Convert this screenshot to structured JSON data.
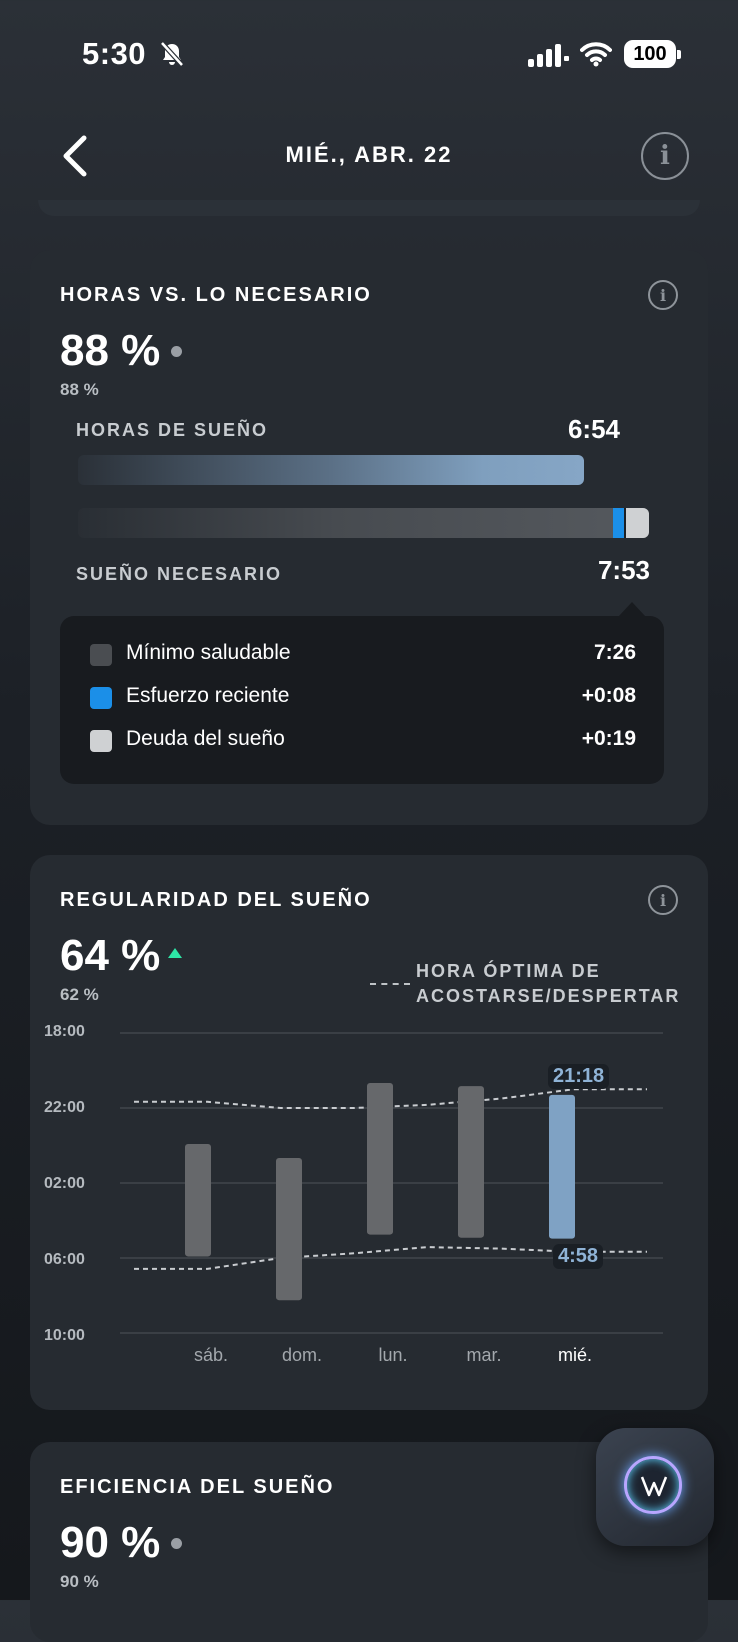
{
  "status_bar": {
    "time": "5:30",
    "battery": "100"
  },
  "header": {
    "title": "MIÉ., ABR. 22"
  },
  "hours_card": {
    "title": "HORAS VS. LO NECESARIO",
    "percent": "88 %",
    "previous_percent": "88 %",
    "sleep_hours_label": "HORAS DE SUEÑO",
    "sleep_hours_value": "6:54",
    "sleep_needed_label": "SUEÑO NECESARIO",
    "sleep_needed_value": "7:53",
    "legend": [
      {
        "label": "Mínimo saludable",
        "value": "7:26",
        "color": "#4a4d51"
      },
      {
        "label": "Esfuerzo reciente",
        "value": "+0:08",
        "color": "#1b8fe8"
      },
      {
        "label": "Deuda del sueño",
        "value": "+0:19",
        "color": "#cfd1d3"
      }
    ]
  },
  "regularity_card": {
    "title": "REGULARIDAD DEL SUEÑO",
    "percent": "64 %",
    "previous_percent": "62 %",
    "trend": "up",
    "legend_line1": "HORA ÓPTIMA DE",
    "legend_line2": "ACOSTARSE/DESPERTAR",
    "bedtime_callout": "21:18",
    "wake_callout": "4:58"
  },
  "efficiency_card": {
    "title": "EFICIENCIA DEL SUEÑO",
    "percent": "90 %",
    "previous_percent": "90 %"
  },
  "chart_data": {
    "type": "bar",
    "title": "",
    "y_axis_ticks": [
      "18:00",
      "22:00",
      "02:00",
      "06:00",
      "10:00"
    ],
    "y_range_hours_since_18": [
      0,
      16
    ],
    "categories": [
      "sáb.",
      "dom.",
      "lun.",
      "mar.",
      "mié."
    ],
    "active_category": "mié.",
    "sleep_ranges": [
      {
        "day": "sáb.",
        "start": "23:55",
        "end": "05:55"
      },
      {
        "day": "dom.",
        "start": "00:40",
        "end": "08:15"
      },
      {
        "day": "lun.",
        "start": "20:40",
        "end": "04:45"
      },
      {
        "day": "mar.",
        "start": "20:50",
        "end": "04:55"
      },
      {
        "day": "mié.",
        "start": "21:18",
        "end": "4:58"
      }
    ],
    "optimal_bedtime": [
      "21:40",
      "21:40",
      "22:00",
      "22:00",
      "21:50",
      "21:30",
      "21:00",
      "21:00"
    ],
    "optimal_wake": [
      "06:35",
      "06:35",
      "06:00",
      "05:45",
      "05:25",
      "05:30",
      "05:40",
      "05:40"
    ],
    "colors": {
      "bar": "#66686b",
      "active_bar": "#7fa2c4",
      "optimal_line": "#c9ccd0"
    }
  }
}
